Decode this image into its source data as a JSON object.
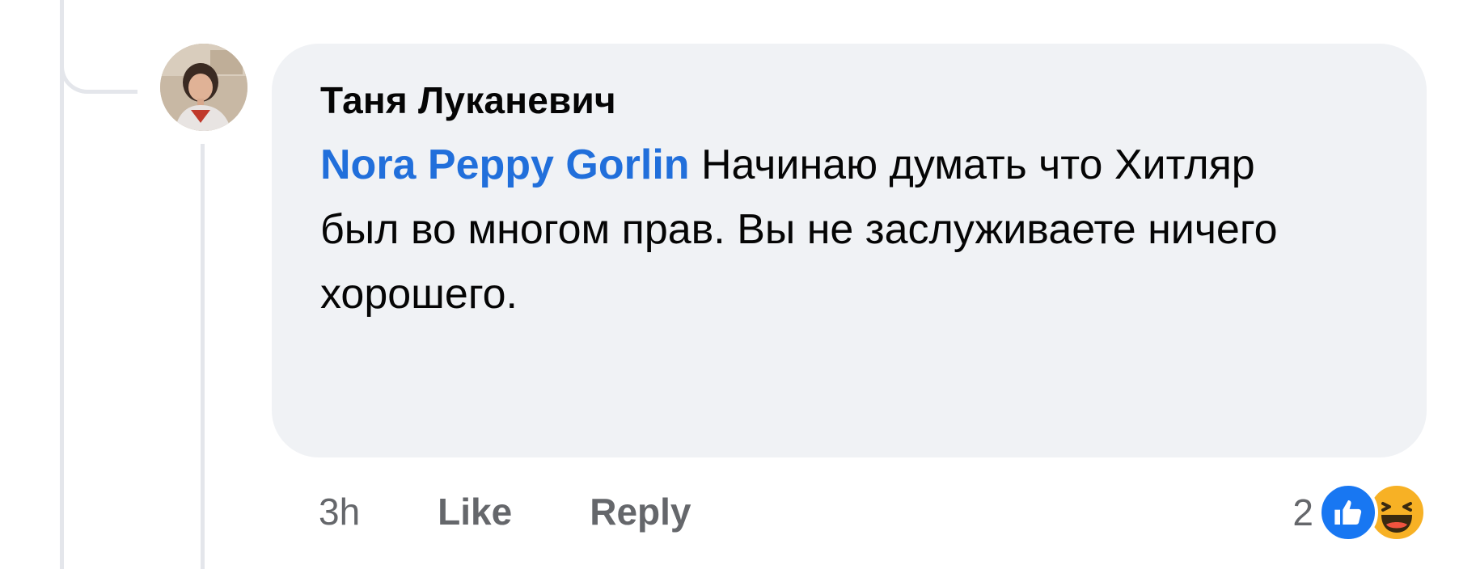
{
  "comment": {
    "author": "Таня Луканевич",
    "mention": "Nora Peppy Gorlin",
    "text": " Начинаю думать что Хитляр был во многом прав. Вы не заслуживаете ничего хорошего."
  },
  "actions": {
    "time": "3h",
    "like_label": "Like",
    "reply_label": "Reply"
  },
  "reactions": {
    "count": "2",
    "types": [
      "like-icon",
      "haha-icon"
    ],
    "colors": {
      "like": "#1877f2",
      "haha": "#f7b125"
    }
  },
  "colors": {
    "bubble": "#f0f2f5",
    "mention": "#216fdb",
    "secondary_text": "#65676b"
  }
}
